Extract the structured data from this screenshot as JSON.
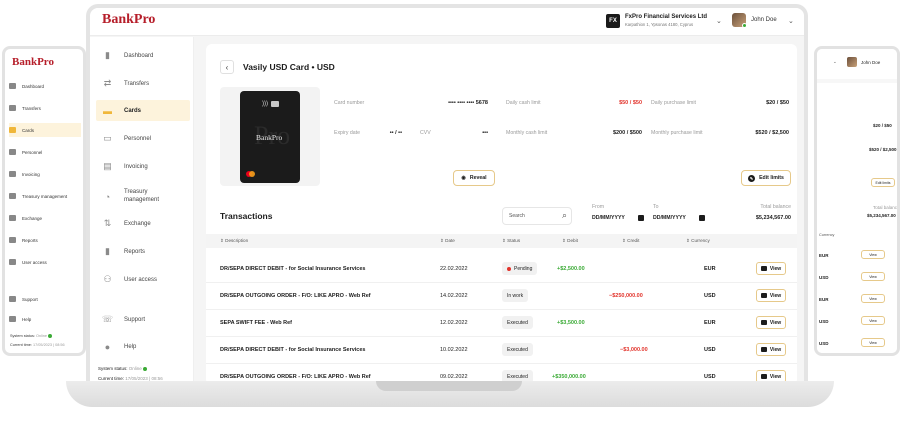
{
  "brand": "BankPro",
  "header": {
    "fx_badge": "FX",
    "company_name": "FxPro Financial Services Ltd",
    "company_address": "Karpathion 1, Ypsonas 4180, Cyprus",
    "user_name": "John Doe"
  },
  "sidebar": {
    "items": [
      {
        "label": "Dashboard",
        "icon": "bar-chart-icon"
      },
      {
        "label": "Transfers",
        "icon": "transfer-icon"
      },
      {
        "label": "Cards",
        "icon": "card-icon",
        "active": true
      },
      {
        "label": "Personnel",
        "icon": "id-card-icon"
      },
      {
        "label": "Invoicing",
        "icon": "invoice-icon"
      },
      {
        "label": "Treasury management",
        "icon": "pie-chart-icon"
      },
      {
        "label": "Exchange",
        "icon": "exchange-icon"
      },
      {
        "label": "Reports",
        "icon": "reports-icon"
      },
      {
        "label": "User access",
        "icon": "users-icon"
      },
      {
        "label": "Support",
        "icon": "support-icon"
      },
      {
        "label": "Help",
        "icon": "help-icon"
      }
    ],
    "system_status_label": "System status:",
    "system_status_value": "Online",
    "current_time_label": "Current time:",
    "current_time_value": "17/05/2023 | 08:56"
  },
  "card": {
    "title": "Vasily USD Card • USD",
    "card_brand": "BankPro",
    "card_number_label": "Card number",
    "card_number_value": "•••• •••• •••• 5678",
    "expiry_label": "Expiry date",
    "expiry_value": "•• / ••",
    "cvv_label": "CVV",
    "cvv_value": "•••",
    "daily_cash_label": "Daily cash limit",
    "daily_cash_value": "$50 / $50",
    "daily_purchase_label": "Daily purchase limit",
    "daily_purchase_value": "$20 / $50",
    "monthly_cash_label": "Monthly cash limit",
    "monthly_cash_value": "$200 / $500",
    "monthly_purchase_label": "Monthly purchase limit",
    "monthly_purchase_value": "$520 / $2,500",
    "reveal_label": "Reveal",
    "edit_limits_label": "Edit limits"
  },
  "transactions": {
    "title": "Transactions",
    "search_placeholder": "Search",
    "from_label": "From",
    "from_value": "DD/MM/YYYY",
    "to_label": "To",
    "to_value": "DD/MM/YYYY",
    "total_balance_label": "Total balance",
    "total_balance_value": "$5,234,567.00",
    "columns": [
      "Description",
      "Date",
      "Status",
      "Debit",
      "Credit",
      "Currency"
    ],
    "view_label": "View",
    "rows": [
      {
        "description": "DR/SEPA DIRECT DEBIT - for Social Insurance Services",
        "date": "22.02.2022",
        "status": "Pending",
        "debit": "+$2,500.00",
        "credit": "",
        "currency": "EUR"
      },
      {
        "description": "DR/SEPA OUTGOING ORDER - F/O: LIKE APRO - Web Ref",
        "date": "14.02.2022",
        "status": "In work",
        "debit": "",
        "credit": "−$250,000.00",
        "currency": "USD"
      },
      {
        "description": "SEPA SWIFT FEE - Web Ref",
        "date": "12.02.2022",
        "status": "Executed",
        "debit": "+$3,500.00",
        "credit": "",
        "currency": "EUR"
      },
      {
        "description": "DR/SEPA DIRECT DEBIT - for Social Insurance Services",
        "date": "10.02.2022",
        "status": "Executed",
        "debit": "",
        "credit": "−$3,000.00",
        "currency": "USD"
      },
      {
        "description": "DR/SEPA OUTGOING ORDER - F/O: LIKE APRO - Web Ref",
        "date": "09.02.2022",
        "status": "Executed",
        "debit": "+$350,000.00",
        "credit": "",
        "currency": "USD"
      }
    ]
  },
  "right_frame": {
    "user_name": "John Doe",
    "monthly_purchase_value": "$520 / $2,500",
    "daily_purchase_value": "$20 / $50",
    "edit_limits_label": "Edit limits",
    "total_balance_label": "Total balance",
    "total_balance_value": "$5,234,567.00",
    "currency_header": "Currency",
    "currencies": [
      "EUR",
      "USD",
      "EUR",
      "USD",
      "USD"
    ],
    "view_label": "View"
  },
  "colors": {
    "brand_red": "#b61e2a",
    "accent_gold": "#f0b73a",
    "positive": "#3aaa35",
    "negative": "#e2332b"
  }
}
